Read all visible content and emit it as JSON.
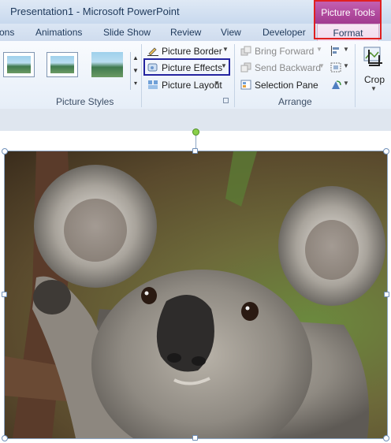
{
  "window": {
    "title": "Presentation1  -  Microsoft PowerPoint"
  },
  "contextual_tab": {
    "group_label": "Picture Tools",
    "tab_label": "Format",
    "color": "#a13a8f"
  },
  "tabs": [
    "ons",
    "Animations",
    "Slide Show",
    "Review",
    "View",
    "Developer"
  ],
  "ribbon": {
    "picture_styles": {
      "group_label": "Picture Styles",
      "thumbnails": [
        "style-1",
        "style-2",
        "style-3"
      ],
      "commands": {
        "border": "Picture Border",
        "effects": "Picture Effects",
        "layout": "Picture Layout"
      }
    },
    "arrange": {
      "group_label": "Arrange",
      "bring_forward": "Bring Forward",
      "send_backward": "Send Backward",
      "selection_pane": "Selection Pane"
    },
    "size": {
      "crop": "Crop"
    }
  },
  "slide": {
    "picture_subject": "koala",
    "highlight_color": "#2424a0",
    "accent_outline": "#e02020"
  }
}
